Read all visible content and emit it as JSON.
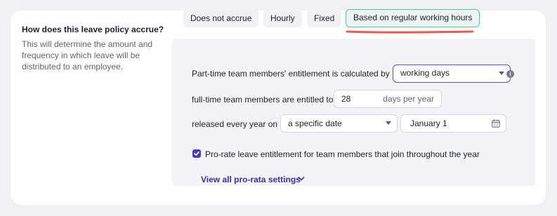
{
  "section": {
    "title": "How does this leave policy accrue?",
    "description": "This will determine the amount and frequency in which leave will be distributed to an employee."
  },
  "accrual_options": {
    "opt1": "Does not accrue",
    "opt2": "Hourly",
    "opt3": "Fixed",
    "opt4": "Based on regular working hours",
    "selected": "Based on regular working hours"
  },
  "form": {
    "parttime_label": "Part-time team members' entitlement is calculated by",
    "parttime_value": "working days",
    "fulltime_label": "full-time team members are entitled to",
    "fulltime_value": "28",
    "fulltime_suffix": "days per year",
    "release_label": "released every year on",
    "release_mode": "a specific date",
    "release_date": "January 1",
    "prorate_label": "Pro-rate leave entitlement for team members that join throughout the year",
    "prorate_checked": true,
    "view_all_link": "View all pro-rata settings"
  },
  "colors": {
    "accent_teal": "#5fb9b3",
    "accent_purple": "#4b3fb0",
    "highlight_red": "#ef5a4a"
  }
}
